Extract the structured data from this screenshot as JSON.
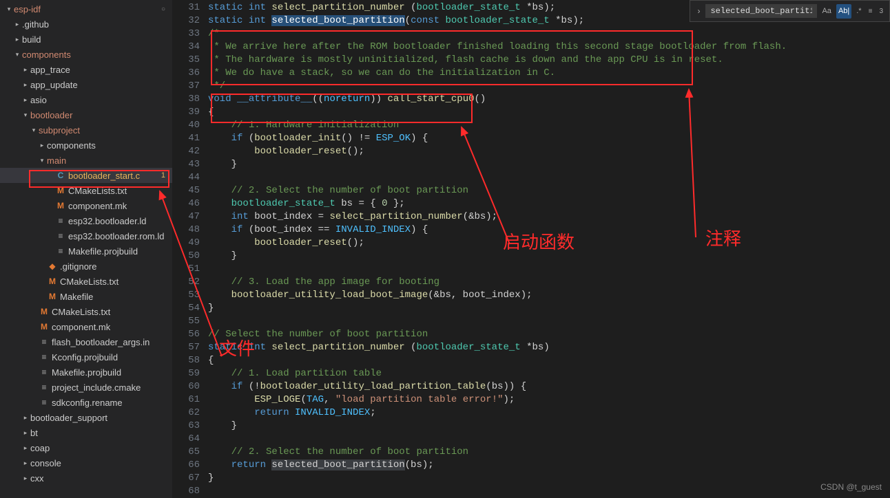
{
  "sidebar": {
    "items": [
      {
        "indent": 0,
        "chev": "v",
        "icon": "",
        "label": "esp-idf",
        "cls": "redish",
        "dot": true
      },
      {
        "indent": 1,
        "chev": ">",
        "icon": "",
        "label": ".github"
      },
      {
        "indent": 1,
        "chev": ">",
        "icon": "",
        "label": "build"
      },
      {
        "indent": 1,
        "chev": "v",
        "icon": "",
        "label": "components",
        "cls": "redish"
      },
      {
        "indent": 2,
        "chev": ">",
        "icon": "",
        "label": "app_trace"
      },
      {
        "indent": 2,
        "chev": ">",
        "icon": "",
        "label": "app_update"
      },
      {
        "indent": 2,
        "chev": ">",
        "icon": "",
        "label": "asio"
      },
      {
        "indent": 2,
        "chev": "v",
        "icon": "",
        "label": "bootloader",
        "cls": "redish"
      },
      {
        "indent": 3,
        "chev": "v",
        "icon": "",
        "label": "subproject",
        "cls": "redish"
      },
      {
        "indent": 4,
        "chev": ">",
        "icon": "",
        "label": "components"
      },
      {
        "indent": 4,
        "chev": "v",
        "icon": "",
        "label": "main",
        "cls": "redish"
      },
      {
        "indent": 5,
        "chev": "",
        "icon": "C",
        "label": "bootloader_start.c",
        "cls": "orange",
        "active": true,
        "badge": "1"
      },
      {
        "indent": 5,
        "chev": "",
        "icon": "M",
        "label": "CMakeLists.txt"
      },
      {
        "indent": 5,
        "chev": "",
        "icon": "M",
        "label": "component.mk"
      },
      {
        "indent": 5,
        "chev": "",
        "icon": "≡",
        "label": "esp32.bootloader.ld"
      },
      {
        "indent": 5,
        "chev": "",
        "icon": "≡",
        "label": "esp32.bootloader.rom.ld"
      },
      {
        "indent": 5,
        "chev": "",
        "icon": "≡",
        "label": "Makefile.projbuild"
      },
      {
        "indent": 4,
        "chev": "",
        "icon": "◆",
        "label": ".gitignore",
        "iconcls": "icon-git"
      },
      {
        "indent": 4,
        "chev": "",
        "icon": "M",
        "label": "CMakeLists.txt"
      },
      {
        "indent": 4,
        "chev": "",
        "icon": "M",
        "label": "Makefile"
      },
      {
        "indent": 3,
        "chev": "",
        "icon": "M",
        "label": "CMakeLists.txt"
      },
      {
        "indent": 3,
        "chev": "",
        "icon": "M",
        "label": "component.mk"
      },
      {
        "indent": 3,
        "chev": "",
        "icon": "≡",
        "label": "flash_bootloader_args.in"
      },
      {
        "indent": 3,
        "chev": "",
        "icon": "≡",
        "label": "Kconfig.projbuild"
      },
      {
        "indent": 3,
        "chev": "",
        "icon": "≡",
        "label": "Makefile.projbuild"
      },
      {
        "indent": 3,
        "chev": "",
        "icon": "≡",
        "label": "project_include.cmake"
      },
      {
        "indent": 3,
        "chev": "",
        "icon": "≡",
        "label": "sdkconfig.rename"
      },
      {
        "indent": 2,
        "chev": ">",
        "icon": "",
        "label": "bootloader_support"
      },
      {
        "indent": 2,
        "chev": ">",
        "icon": "",
        "label": "bt"
      },
      {
        "indent": 2,
        "chev": ">",
        "icon": "",
        "label": "coap"
      },
      {
        "indent": 2,
        "chev": ">",
        "icon": "",
        "label": "console"
      },
      {
        "indent": 2,
        "chev": ">",
        "icon": "",
        "label": "cxx"
      }
    ]
  },
  "find": {
    "value": "selected_boot_partition",
    "caseSensitive": "Aa",
    "wholeWord": "Ab|",
    "regex": ".*"
  },
  "editor": {
    "startLine": 31,
    "lines": [
      [
        {
          "t": "static ",
          "c": "kw"
        },
        {
          "t": "int ",
          "c": "kw"
        },
        {
          "t": "select_partition_number ",
          "c": "func"
        },
        {
          "t": "(",
          "c": "plain"
        },
        {
          "t": "bootloader_state_t ",
          "c": "type"
        },
        {
          "t": "*bs);",
          "c": "plain"
        }
      ],
      [
        {
          "t": "static ",
          "c": "kw"
        },
        {
          "t": "int ",
          "c": "kw"
        },
        {
          "t": "selected_boot_partition",
          "c": "func",
          "sel": "hard"
        },
        {
          "t": "(",
          "c": "plain"
        },
        {
          "t": "const ",
          "c": "kw"
        },
        {
          "t": "bootloader_state_t ",
          "c": "type"
        },
        {
          "t": "*bs);",
          "c": "plain"
        }
      ],
      [
        {
          "t": "/*",
          "c": "cmt"
        }
      ],
      [
        {
          "t": " * We arrive here after the ROM bootloader finished loading this second stage bootloader from flash.",
          "c": "cmt"
        }
      ],
      [
        {
          "t": " * The hardware is mostly uninitialized, flash cache is down and the app CPU is in reset.",
          "c": "cmt"
        }
      ],
      [
        {
          "t": " * We do have a stack, so we can do the initialization in C.",
          "c": "cmt"
        }
      ],
      [
        {
          "t": " */",
          "c": "cmt"
        }
      ],
      [
        {
          "t": "void ",
          "c": "kw"
        },
        {
          "t": "__attribute__",
          "c": "kw"
        },
        {
          "t": "((",
          "c": "plain"
        },
        {
          "t": "noreturn",
          "c": "const"
        },
        {
          "t": ")) ",
          "c": "plain"
        },
        {
          "t": "call_start_cpu0",
          "c": "func"
        },
        {
          "t": "()",
          "c": "plain"
        }
      ],
      [
        {
          "t": "{",
          "c": "plain"
        }
      ],
      [
        {
          "t": "    ",
          "c": "plain"
        },
        {
          "t": "// 1. Hardware initialization",
          "c": "cmt"
        }
      ],
      [
        {
          "t": "    ",
          "c": "plain"
        },
        {
          "t": "if ",
          "c": "kw"
        },
        {
          "t": "(",
          "c": "plain"
        },
        {
          "t": "bootloader_init",
          "c": "func"
        },
        {
          "t": "() != ",
          "c": "plain"
        },
        {
          "t": "ESP_OK",
          "c": "enum"
        },
        {
          "t": ") {",
          "c": "plain"
        }
      ],
      [
        {
          "t": "        ",
          "c": "plain"
        },
        {
          "t": "bootloader_reset",
          "c": "func"
        },
        {
          "t": "();",
          "c": "plain"
        }
      ],
      [
        {
          "t": "    }",
          "c": "plain"
        }
      ],
      [
        {
          "t": "",
          "c": "plain"
        }
      ],
      [
        {
          "t": "    ",
          "c": "plain"
        },
        {
          "t": "// 2. Select the number of boot partition",
          "c": "cmt"
        }
      ],
      [
        {
          "t": "    ",
          "c": "plain"
        },
        {
          "t": "bootloader_state_t ",
          "c": "type"
        },
        {
          "t": "bs = { ",
          "c": "plain"
        },
        {
          "t": "0",
          "c": "num"
        },
        {
          "t": " };",
          "c": "plain"
        }
      ],
      [
        {
          "t": "    ",
          "c": "plain"
        },
        {
          "t": "int ",
          "c": "kw"
        },
        {
          "t": "boot_index = ",
          "c": "plain"
        },
        {
          "t": "select_partition_number",
          "c": "func"
        },
        {
          "t": "(&bs);",
          "c": "plain"
        }
      ],
      [
        {
          "t": "    ",
          "c": "plain"
        },
        {
          "t": "if ",
          "c": "kw"
        },
        {
          "t": "(boot_index == ",
          "c": "plain"
        },
        {
          "t": "INVALID_INDEX",
          "c": "enum"
        },
        {
          "t": ") {",
          "c": "plain"
        }
      ],
      [
        {
          "t": "        ",
          "c": "plain"
        },
        {
          "t": "bootloader_reset",
          "c": "func"
        },
        {
          "t": "();",
          "c": "plain"
        }
      ],
      [
        {
          "t": "    }",
          "c": "plain"
        }
      ],
      [
        {
          "t": "",
          "c": "plain"
        }
      ],
      [
        {
          "t": "    ",
          "c": "plain"
        },
        {
          "t": "// 3. Load the app image for booting",
          "c": "cmt"
        }
      ],
      [
        {
          "t": "    ",
          "c": "plain"
        },
        {
          "t": "bootloader_utility_load_boot_image",
          "c": "func"
        },
        {
          "t": "(&bs, boot_index);",
          "c": "plain"
        }
      ],
      [
        {
          "t": "}",
          "c": "plain"
        }
      ],
      [
        {
          "t": "",
          "c": "plain"
        }
      ],
      [
        {
          "t": "// Select the number of boot partition",
          "c": "cmt"
        }
      ],
      [
        {
          "t": "static ",
          "c": "kw"
        },
        {
          "t": "int ",
          "c": "kw"
        },
        {
          "t": "select_partition_number ",
          "c": "func"
        },
        {
          "t": "(",
          "c": "plain"
        },
        {
          "t": "bootloader_state_t ",
          "c": "type"
        },
        {
          "t": "*bs)",
          "c": "plain"
        }
      ],
      [
        {
          "t": "{",
          "c": "plain"
        }
      ],
      [
        {
          "t": "    ",
          "c": "plain"
        },
        {
          "t": "// 1. Load partition table",
          "c": "cmt"
        }
      ],
      [
        {
          "t": "    ",
          "c": "plain"
        },
        {
          "t": "if ",
          "c": "kw"
        },
        {
          "t": "(!",
          "c": "plain"
        },
        {
          "t": "bootloader_utility_load_partition_table",
          "c": "func"
        },
        {
          "t": "(bs)) {",
          "c": "plain"
        }
      ],
      [
        {
          "t": "        ",
          "c": "plain"
        },
        {
          "t": "ESP_LOGE",
          "c": "func"
        },
        {
          "t": "(",
          "c": "plain"
        },
        {
          "t": "TAG",
          "c": "const"
        },
        {
          "t": ", ",
          "c": "plain"
        },
        {
          "t": "\"load partition table error!\"",
          "c": "str"
        },
        {
          "t": ");",
          "c": "plain"
        }
      ],
      [
        {
          "t": "        ",
          "c": "plain"
        },
        {
          "t": "return ",
          "c": "kw"
        },
        {
          "t": "INVALID_INDEX",
          "c": "enum"
        },
        {
          "t": ";",
          "c": "plain"
        }
      ],
      [
        {
          "t": "    }",
          "c": "plain"
        }
      ],
      [
        {
          "t": "",
          "c": "plain"
        }
      ],
      [
        {
          "t": "    ",
          "c": "plain"
        },
        {
          "t": "// 2. Select the number of boot partition",
          "c": "cmt"
        }
      ],
      [
        {
          "t": "    ",
          "c": "plain"
        },
        {
          "t": "return ",
          "c": "kw"
        },
        {
          "t": "selected_boot_partition",
          "c": "func",
          "sel": "soft"
        },
        {
          "t": "(bs);",
          "c": "plain"
        }
      ],
      [
        {
          "t": "}",
          "c": "plain"
        }
      ],
      [
        {
          "t": "",
          "c": "plain"
        }
      ]
    ]
  },
  "annotations": {
    "startFuncLabel": "启动函数",
    "commentLabel": "注释",
    "fileLabel": "文件"
  },
  "watermark": "CSDN @t_guest"
}
